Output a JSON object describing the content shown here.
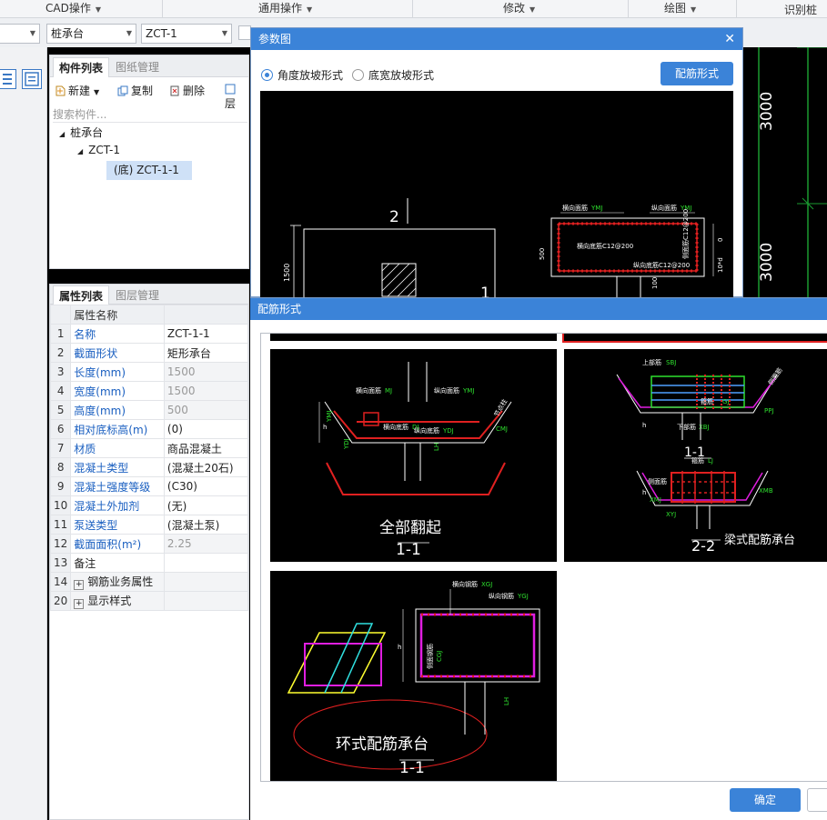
{
  "menubar": {
    "items": [
      "CAD操作",
      "通用操作",
      "修改",
      "绘图",
      "识别桩承"
    ]
  },
  "selectors": {
    "floor": "",
    "type": "桩承台",
    "component": "ZCT-1"
  },
  "component_panel": {
    "tabs": [
      "构件列表",
      "图纸管理"
    ],
    "toolbar": {
      "new": "新建",
      "copy": "复制",
      "delete": "删除",
      "layer": "层"
    },
    "search_placeholder": "搜索构件...",
    "tree": {
      "root": "桩承台",
      "child": "ZCT-1",
      "leaf": "(底) ZCT-1-1"
    }
  },
  "property_panel": {
    "tabs": [
      "属性列表",
      "图层管理"
    ],
    "header": "属性名称",
    "rows": [
      {
        "n": "1",
        "k": "名称",
        "v": "ZCT-1-1",
        "key_style": "link",
        "val_style": "normal"
      },
      {
        "n": "2",
        "k": "截面形状",
        "v": "矩形承台",
        "key_style": "link",
        "val_style": "normal"
      },
      {
        "n": "3",
        "k": "长度(mm)",
        "v": "1500",
        "key_style": "link",
        "val_style": "gray"
      },
      {
        "n": "4",
        "k": "宽度(mm)",
        "v": "1500",
        "key_style": "link",
        "val_style": "gray"
      },
      {
        "n": "5",
        "k": "高度(mm)",
        "v": "500",
        "key_style": "link",
        "val_style": "gray"
      },
      {
        "n": "6",
        "k": "相对底标高(m)",
        "v": "(0)",
        "key_style": "link",
        "val_style": "normal"
      },
      {
        "n": "7",
        "k": "材质",
        "v": "商品混凝土",
        "key_style": "link",
        "val_style": "normal"
      },
      {
        "n": "8",
        "k": "混凝土类型",
        "v": "(混凝土20石)",
        "key_style": "link",
        "val_style": "normal"
      },
      {
        "n": "9",
        "k": "混凝土强度等级",
        "v": "(C30)",
        "key_style": "link",
        "val_style": "normal"
      },
      {
        "n": "10",
        "k": "混凝土外加剂",
        "v": "(无)",
        "key_style": "link",
        "val_style": "normal"
      },
      {
        "n": "11",
        "k": "泵送类型",
        "v": "(混凝土泵)",
        "key_style": "link",
        "val_style": "normal"
      },
      {
        "n": "12",
        "k": "截面面积(m²)",
        "v": "2.25",
        "key_style": "link",
        "val_style": "gray"
      },
      {
        "n": "13",
        "k": "备注",
        "v": "",
        "key_style": "plain",
        "val_style": "normal"
      },
      {
        "n": "14",
        "k": "钢筋业务属性",
        "v": "",
        "key_style": "group",
        "val_style": "group"
      },
      {
        "n": "20",
        "k": "显示样式",
        "v": "",
        "key_style": "group",
        "val_style": "group"
      }
    ]
  },
  "param_dialog": {
    "title": "参数图",
    "radio_angle": "角度放坡形式",
    "radio_width": "底宽放坡形式",
    "rebar_button": "配筋形式",
    "drawing_labels": {
      "section_mark": "2",
      "section_mark2": "1",
      "dim_1500": "1500",
      "dim_500": "500",
      "dim_100": "100",
      "dim_0": "0",
      "t1": "横向面筋",
      "t1c": "YMJ",
      "t2": "纵向面筋",
      "t2c": "YMJ",
      "t3": "横向底筋C12@200",
      "t4": "侧面筋C12@200",
      "t5": "纵向底筋C12@200",
      "t6": "10*d"
    }
  },
  "rebar_dialog": {
    "title": "配筋形式",
    "confirm": "确定",
    "thumb1": {
      "caption": "全部翻起",
      "section": "1-1",
      "l1": "横向面筋",
      "l1c": "MJ",
      "l2": "纵向面筋",
      "l2c": "YMJ",
      "l3": "横向底筋",
      "l3c": "DJ",
      "l4": "纵向底筋",
      "l4c": "YDJ",
      "l5": "节点柱",
      "l6": "CMJ",
      "l7": "h",
      "l8": "YMJ",
      "l9": "YDJ",
      "l10": "LH"
    },
    "thumb2": {
      "caption": "梁式配筋承台",
      "section1": "1-1",
      "section2": "2-2",
      "l1": "上部筋",
      "l1c": "SBJ",
      "l2": "侧面筋",
      "l3": "下部筋",
      "l3c": "XBJ",
      "l4": "箍筋",
      "l4c": "GJ",
      "l5": "箍筋",
      "l5c": "LJ",
      "l6": "侧面筋",
      "l7": "XMJ",
      "l8": "XMB",
      "l9": "XYJ",
      "l10": "h",
      "l11": "PPJ"
    },
    "thumb3": {
      "caption": "环式配筋承台",
      "section": "1-1",
      "l1": "横向钢筋",
      "l1c": "XGJ",
      "l2": "纵向钢筋",
      "l2c": "YGJ",
      "l3": "侧面钢筋",
      "l3c": "CGJ",
      "l4": "h",
      "l5": "LH"
    }
  },
  "background_drawing": {
    "dim1": "3000",
    "dim2": "3000"
  }
}
